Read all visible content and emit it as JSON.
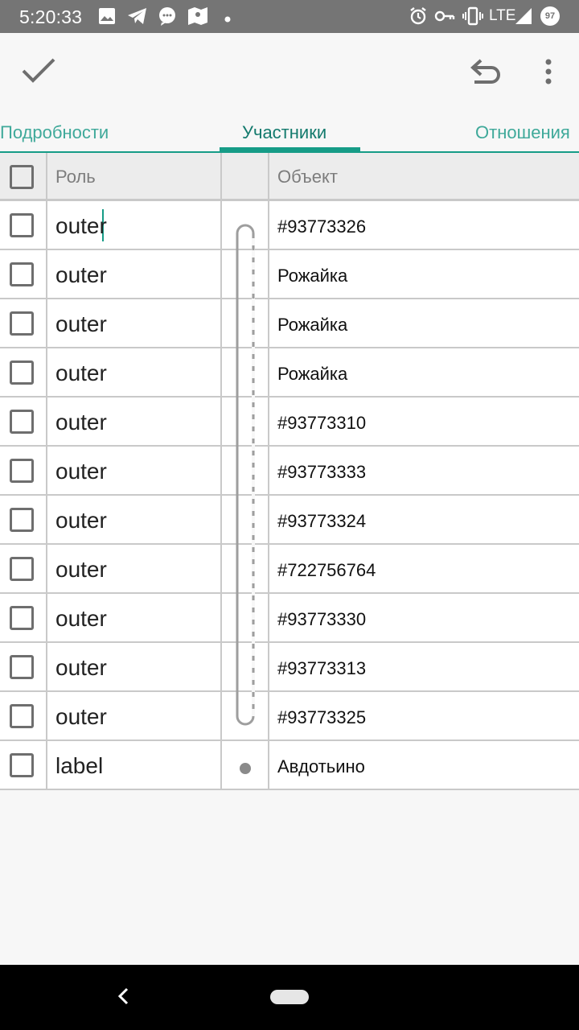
{
  "status_bar": {
    "time": "5:20:33",
    "network": "LTE",
    "battery": "97",
    "icons": [
      "image-icon",
      "telegram-icon",
      "chat-icon",
      "maps-icon",
      "dot-icon",
      "alarm-icon",
      "vpn-key-icon",
      "vibrate-icon",
      "signal-icon",
      "battery-icon"
    ]
  },
  "toolbar": {
    "confirm_icon": "check-icon",
    "undo_icon": "undo-icon",
    "menu_icon": "more-vert-icon"
  },
  "tabs": [
    {
      "label": "Подробности",
      "active": false
    },
    {
      "label": "Участники",
      "active": true
    },
    {
      "label": "Отношения",
      "active": false
    }
  ],
  "table": {
    "headers": {
      "role": "Роль",
      "object": "Объект"
    },
    "rows": [
      {
        "role": "outer",
        "object": "#93773326"
      },
      {
        "role": "outer",
        "object": "Рожайка"
      },
      {
        "role": "outer",
        "object": "Рожайка"
      },
      {
        "role": "outer",
        "object": "Рожайка"
      },
      {
        "role": "outer",
        "object": "#93773310"
      },
      {
        "role": "outer",
        "object": "#93773333"
      },
      {
        "role": "outer",
        "object": "#93773324"
      },
      {
        "role": "outer",
        "object": "#722756764"
      },
      {
        "role": "outer",
        "object": "#93773330"
      },
      {
        "role": "outer",
        "object": "#93773313"
      },
      {
        "role": "outer",
        "object": "#93773325"
      },
      {
        "role": "label",
        "object": "Авдотьино"
      }
    ]
  },
  "nav": {
    "back_icon": "back-chevron-icon",
    "home_icon": "home-pill-icon"
  },
  "colors": {
    "accent": "#169c87",
    "tab_text": "#3fa99a",
    "status_bar": "#757575"
  }
}
